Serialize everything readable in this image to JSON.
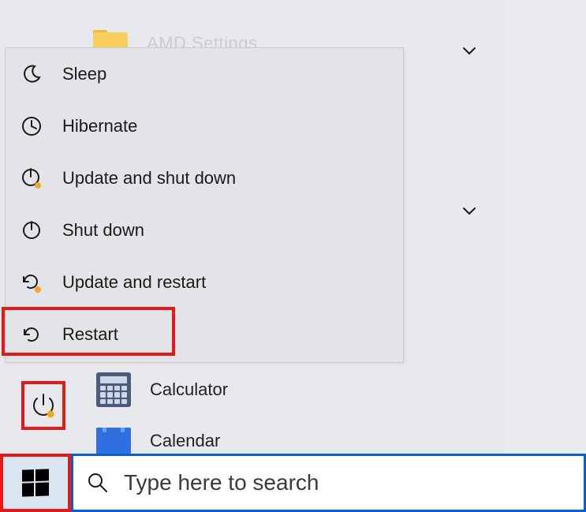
{
  "start_menu": {
    "folder_item_label": "AMD Settings",
    "apps": {
      "calculator_label": "Calculator",
      "calendar_label": "Calendar"
    }
  },
  "power_menu": {
    "items": [
      {
        "icon": "moon-icon",
        "label": "Sleep"
      },
      {
        "icon": "clock-icon",
        "label": "Hibernate"
      },
      {
        "icon": "power-update-icon",
        "label": "Update and shut down"
      },
      {
        "icon": "power-icon",
        "label": "Shut down"
      },
      {
        "icon": "restart-update-icon",
        "label": "Update and restart"
      },
      {
        "icon": "restart-icon",
        "label": "Restart"
      }
    ]
  },
  "taskbar": {
    "search_placeholder": "Type here to search"
  },
  "annotations": {
    "highlight_color": "#e11a1a",
    "search_border_color": "#0a5fcf"
  }
}
